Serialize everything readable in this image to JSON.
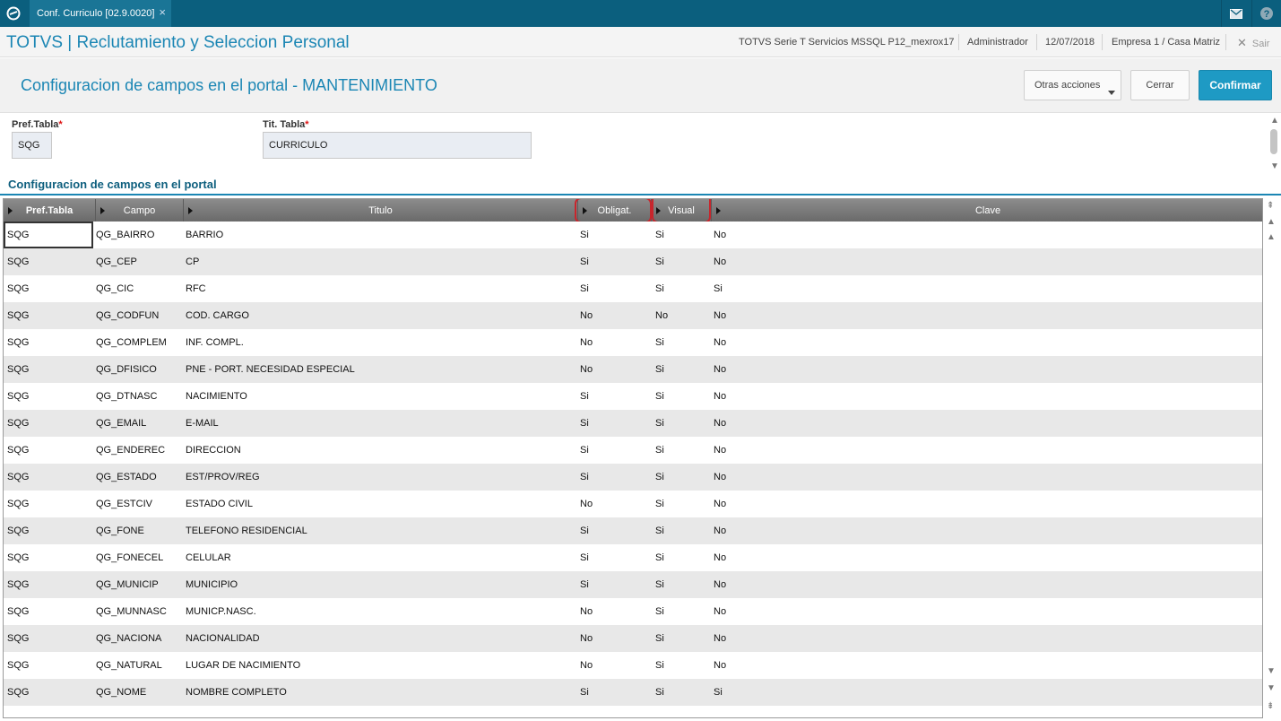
{
  "topbar": {
    "tab_title": "Conf. Curriculo [02.9.0020]",
    "tab_close": "×"
  },
  "header": {
    "app_title": "TOTVS | Reclutamiento y Seleccion Personal",
    "environment": "TOTVS Serie T Servicios MSSQL P12_mexrox17",
    "user": "Administrador",
    "date": "12/07/2018",
    "company": "Empresa 1 / Casa Matriz",
    "exit_label": "Sair"
  },
  "page": {
    "title": "Configuracion de campos en el portal - MANTENIMIENTO",
    "actions": {
      "other": "Otras acciones",
      "close": "Cerrar",
      "confirm": "Confirmar"
    }
  },
  "form": {
    "pref_label": "Pref.Tabla",
    "pref_value": "SQG",
    "tit_label": "Tit. Tabla",
    "tit_value": "CURRICULO",
    "required_mark": "*"
  },
  "section_title": "Configuracion de campos en el portal",
  "grid": {
    "columns": [
      "Pref.Tabla",
      "Campo",
      "Titulo",
      "Obligat.",
      "Visual",
      "Clave"
    ],
    "rows": [
      [
        "SQG",
        "QG_BAIRRO",
        "BARRIO",
        "Si",
        "Si",
        "No"
      ],
      [
        "SQG",
        "QG_CEP",
        "CP",
        "Si",
        "Si",
        "No"
      ],
      [
        "SQG",
        "QG_CIC",
        "RFC",
        "Si",
        "Si",
        "Si"
      ],
      [
        "SQG",
        "QG_CODFUN",
        "COD. CARGO",
        "No",
        "No",
        "No"
      ],
      [
        "SQG",
        "QG_COMPLEM",
        "INF. COMPL.",
        "No",
        "Si",
        "No"
      ],
      [
        "SQG",
        "QG_DFISICO",
        "PNE - PORT. NECESIDAD ESPECIAL",
        "No",
        "Si",
        "No"
      ],
      [
        "SQG",
        "QG_DTNASC",
        "NACIMIENTO",
        "Si",
        "Si",
        "No"
      ],
      [
        "SQG",
        "QG_EMAIL",
        "E-MAIL",
        "Si",
        "Si",
        "No"
      ],
      [
        "SQG",
        "QG_ENDEREC",
        "DIRECCION",
        "Si",
        "Si",
        "No"
      ],
      [
        "SQG",
        "QG_ESTADO",
        "EST/PROV/REG",
        "Si",
        "Si",
        "No"
      ],
      [
        "SQG",
        "QG_ESTCIV",
        "ESTADO CIVIL",
        "No",
        "Si",
        "No"
      ],
      [
        "SQG",
        "QG_FONE",
        "TELEFONO RESIDENCIAL",
        "Si",
        "Si",
        "No"
      ],
      [
        "SQG",
        "QG_FONECEL",
        "CELULAR",
        "Si",
        "Si",
        "No"
      ],
      [
        "SQG",
        "QG_MUNICIP",
        "MUNICIPIO",
        "Si",
        "Si",
        "No"
      ],
      [
        "SQG",
        "QG_MUNNASC",
        "MUNICP.NASC.",
        "No",
        "Si",
        "No"
      ],
      [
        "SQG",
        "QG_NACIONA",
        "NACIONALIDAD",
        "No",
        "Si",
        "No"
      ],
      [
        "SQG",
        "QG_NATURAL",
        "LUGAR DE NACIMIENTO",
        "No",
        "Si",
        "No"
      ],
      [
        "SQG",
        "QG_NOME",
        "NOMBRE COMPLETO",
        "Si",
        "Si",
        "Si"
      ]
    ]
  },
  "icons": [
    "totvs-logo-icon",
    "mail-icon",
    "help-icon",
    "close-icon",
    "sort-arrow-icon",
    "scroll-arrow-icon"
  ],
  "colors": {
    "topbar": "#0b5f7e",
    "accent": "#1b86b4",
    "confirm": "#1e9ac4",
    "highlight": "#c8252c"
  }
}
